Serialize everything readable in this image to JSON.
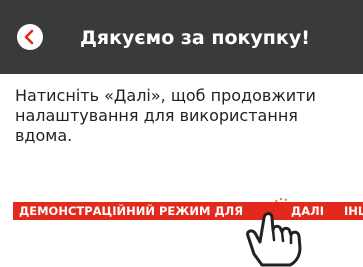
{
  "header": {
    "title": "Дякуємо за покупку!",
    "back_icon": "back-arrow-icon"
  },
  "message": {
    "text": "Натисніть «Далі», щоб продовжити налаштування для використання вдома."
  },
  "demo_bar": {
    "mode_label": "ДЕМОНСТРАЦІЙНИЙ РЕЖИМ ДЛЯ",
    "next_label": "ДАЛІ",
    "other_label": "ІНШ"
  },
  "colors": {
    "header_bg": "#3a3a3a",
    "accent_red": "#e3281c"
  },
  "icons": {
    "hand": "tap-hand-icon"
  }
}
